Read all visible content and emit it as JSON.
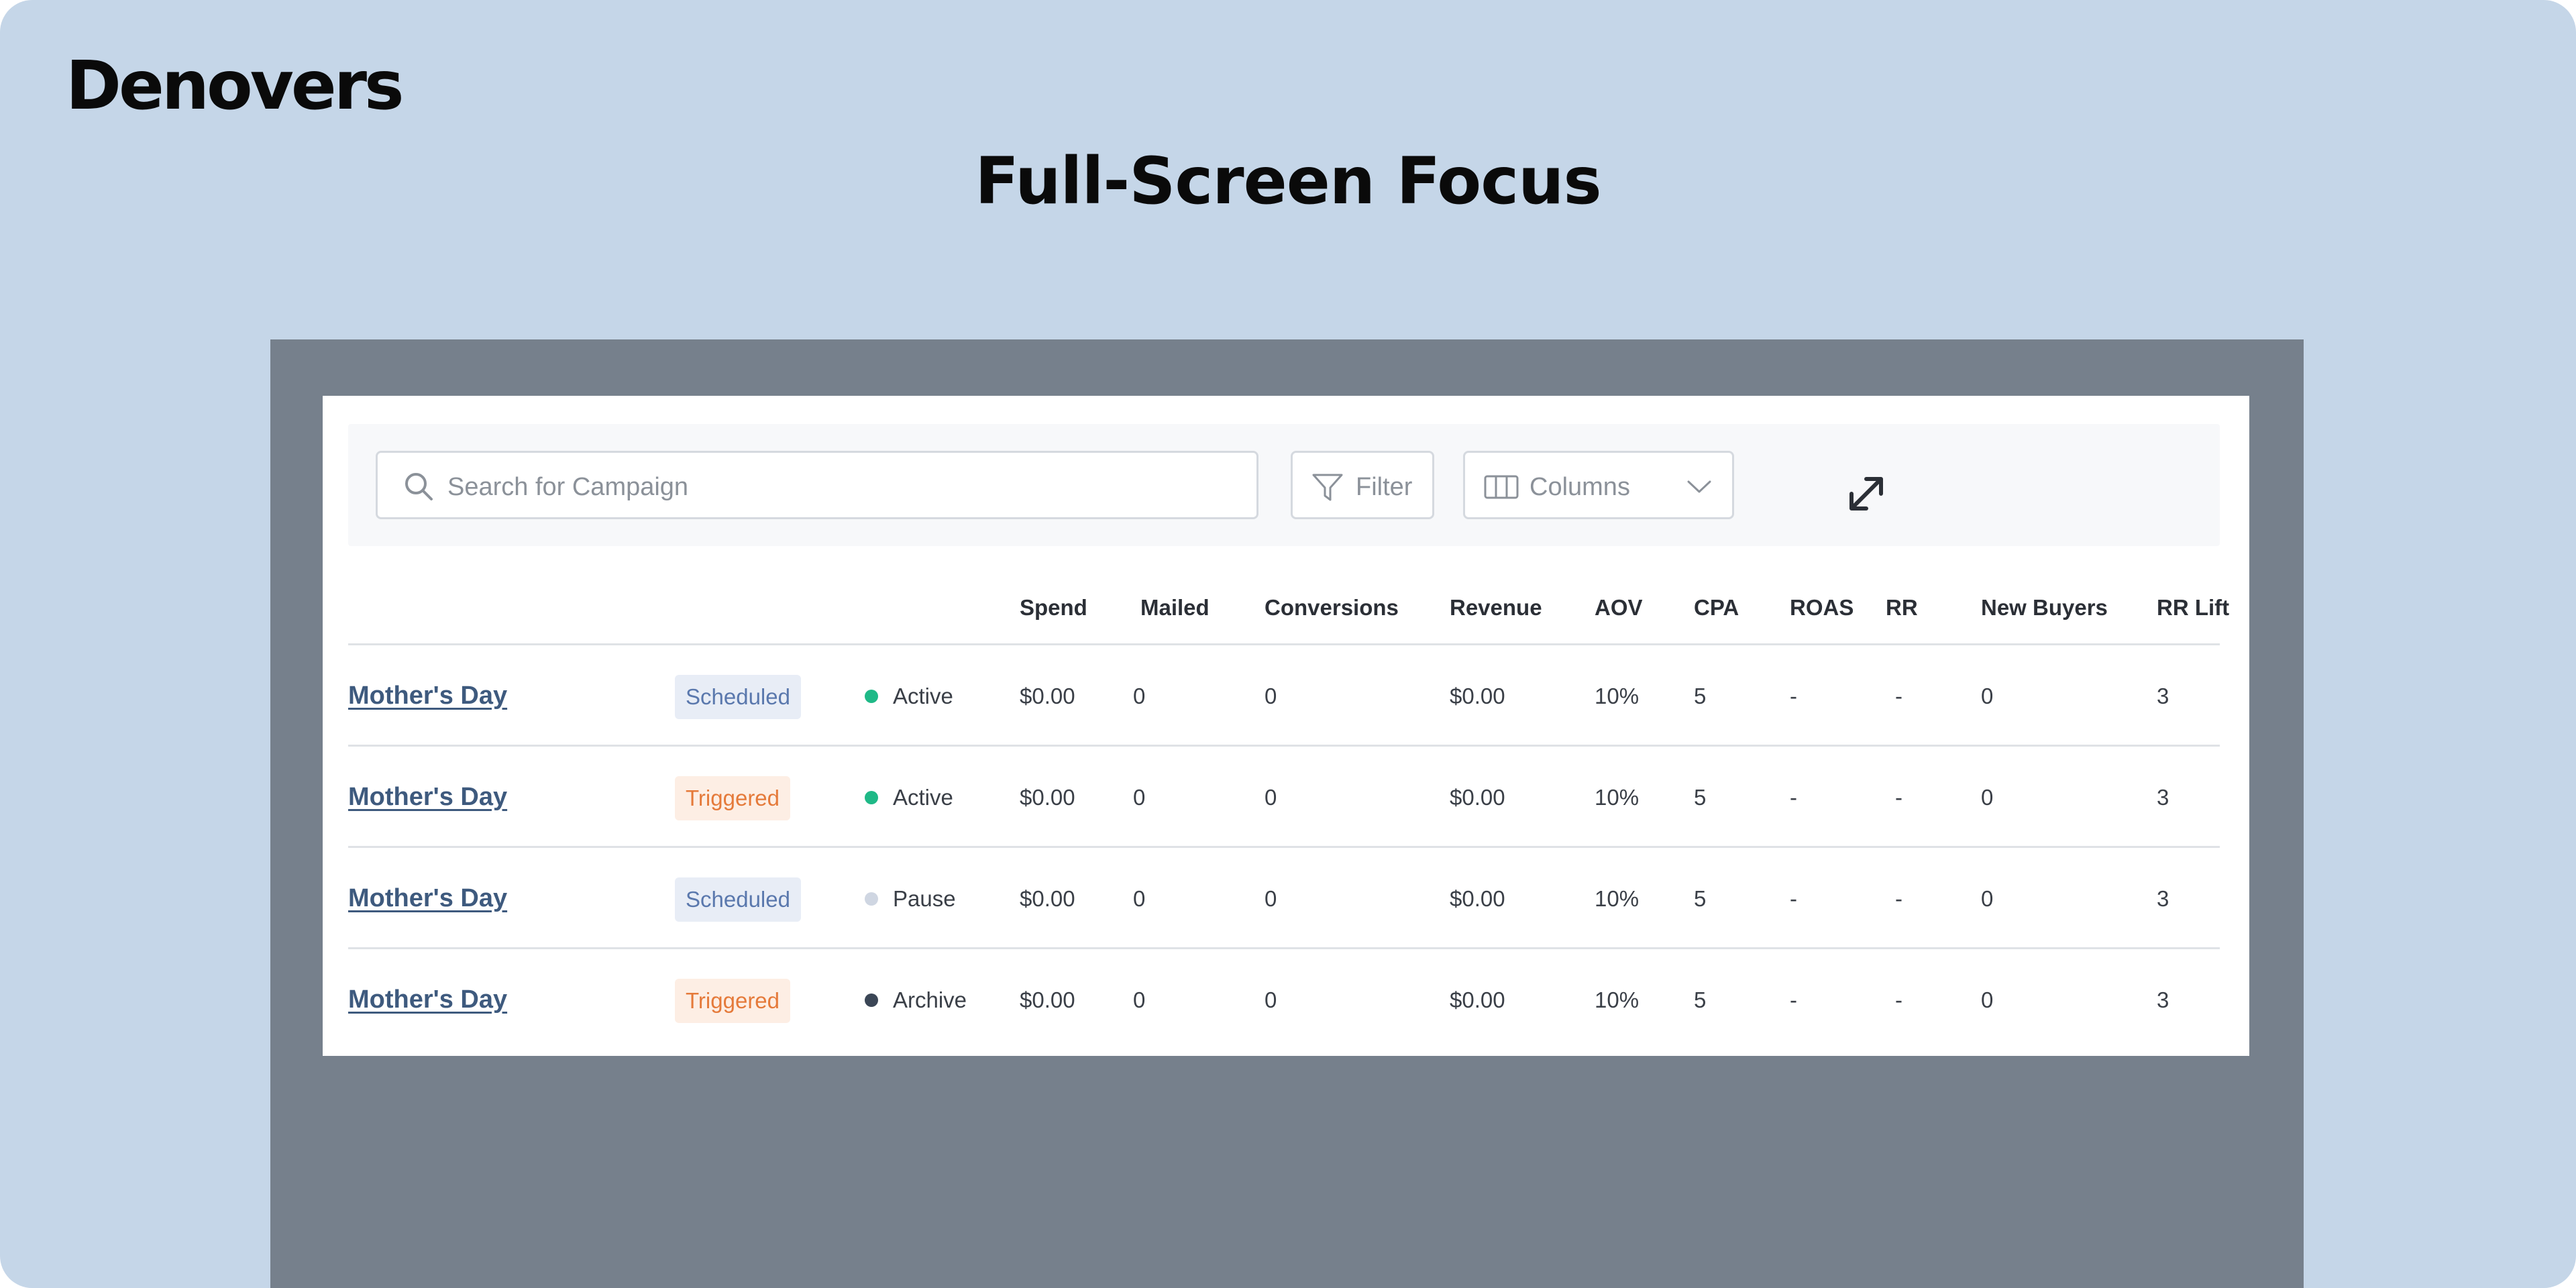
{
  "brand": {
    "name": "Denovers"
  },
  "headline": "Full-Screen Focus",
  "toolbar": {
    "search_placeholder": "Search for Campaign",
    "filter_label": "Filter",
    "columns_label": "Columns"
  },
  "table": {
    "headers": [
      "Spend",
      "Mailed",
      "Conversions",
      "Revenue",
      "AOV",
      "CPA",
      "ROAS",
      "RR",
      "New Buyers",
      "RR Lift"
    ],
    "rows": [
      {
        "name": "Mother's Day",
        "type": "Scheduled",
        "status": "Active",
        "values": [
          "$0.00",
          "0",
          "0",
          "$0.00",
          "10%",
          "5",
          "-",
          "-",
          "0",
          "3"
        ]
      },
      {
        "name": "Mother's Day",
        "type": "Triggered",
        "status": "Active",
        "values": [
          "$0.00",
          "0",
          "0",
          "$0.00",
          "10%",
          "5",
          "-",
          "-",
          "0",
          "3"
        ]
      },
      {
        "name": "Mother's Day",
        "type": "Scheduled",
        "status": "Pause",
        "values": [
          "$0.00",
          "0",
          "0",
          "$0.00",
          "10%",
          "5",
          "-",
          "-",
          "0",
          "3"
        ]
      },
      {
        "name": "Mother's Day",
        "type": "Triggered",
        "status": "Archive",
        "values": [
          "$0.00",
          "0",
          "0",
          "$0.00",
          "10%",
          "5",
          "-",
          "-",
          "0",
          "3"
        ]
      }
    ]
  },
  "colors": {
    "canvas_bg": "#c5d6e8",
    "backdrop": "#76808c",
    "status_active": "#1fb987",
    "status_pause": "#cfd6e2",
    "status_archive": "#3b4656",
    "badge_scheduled": "#5a78ad",
    "badge_triggered": "#e57a3a"
  },
  "icons": {
    "search": "search-icon",
    "filter": "filter-icon",
    "columns": "columns-icon",
    "chevron": "chevron-down-icon",
    "expand": "expand-icon"
  }
}
